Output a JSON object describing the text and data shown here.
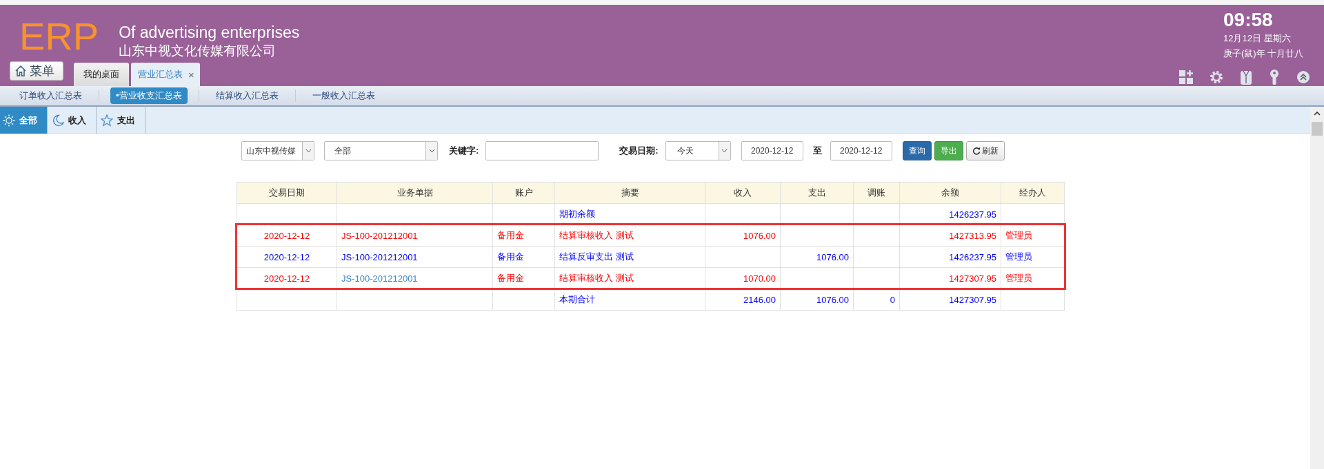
{
  "header": {
    "logo": "ERP",
    "title": "Of advertising enterprises",
    "company": "山东中视文化传媒有限公司",
    "time": "09:58",
    "date": "12月12日 星期六",
    "lunar_date": "庚子(鼠)年 十月廿八"
  },
  "menu_button": {
    "label": "菜单"
  },
  "tabs": [
    {
      "label": "我的桌面",
      "selected": false,
      "closable": false
    },
    {
      "label": "营业汇总表",
      "selected": true,
      "closable": true,
      "close": "×"
    }
  ],
  "sub_nav": [
    {
      "label": "订单收入汇总表",
      "selected": false
    },
    {
      "label": "•营业收支汇总表",
      "selected": true
    },
    {
      "label": "结算收入汇总表",
      "selected": false
    },
    {
      "label": "一般收入汇总表",
      "selected": false
    }
  ],
  "filter_tabs": [
    {
      "label": "全部",
      "selected": true
    },
    {
      "label": "收入",
      "selected": false
    },
    {
      "label": "支出",
      "selected": false
    }
  ],
  "filters": {
    "company": "山东中视传媒",
    "type": "全部",
    "keyword_label": "关键字:",
    "date_label": "交易日期:",
    "date_range": "今天",
    "date_from": "2020-12-12",
    "to_label": "至",
    "date_to": "2020-12-12",
    "buttons": [
      {
        "label": "查询",
        "kind": "query"
      },
      {
        "label": "导出",
        "kind": "export"
      },
      {
        "label": "刷新",
        "kind": "refresh"
      }
    ]
  },
  "table": {
    "columns": [
      "交易日期",
      "业务单据",
      "账户",
      "摘要",
      "收入",
      "支出",
      "调账",
      "余额",
      "经办人"
    ],
    "opening_row": {
      "summary": "期初余额",
      "balance": "1426237.95"
    },
    "rows": [
      {
        "date": "2020-12-12",
        "doc": "JS-100-201212001",
        "account": "备用金",
        "summary": "结算审核收入 测试",
        "income": "1076.00",
        "expense": "",
        "balance": "1427313.95",
        "operator": "管理员",
        "color": "#ff0000",
        "doc_visited": false
      },
      {
        "date": "2020-12-12",
        "doc": "JS-100-201212001",
        "account": "备用金",
        "summary": "结算反审支出 测试",
        "income": "",
        "expense": "1076.00",
        "balance": "1426237.95",
        "operator": "管理员",
        "color": "#0000ff",
        "doc_visited": false
      },
      {
        "date": "2020-12-12",
        "doc": "JS-100-201212001",
        "account": "备用金",
        "summary": "结算审核收入 测试",
        "income": "1070.00",
        "expense": "",
        "balance": "1427307.95",
        "operator": "管理员",
        "color": "#ff0000",
        "doc_visited": true
      }
    ],
    "rows_highlighted": true,
    "total_row": {
      "summary": "本期合计",
      "income": "2146.00",
      "expense": "1076.00",
      "adjust": "0",
      "balance": "1427307.95"
    }
  }
}
